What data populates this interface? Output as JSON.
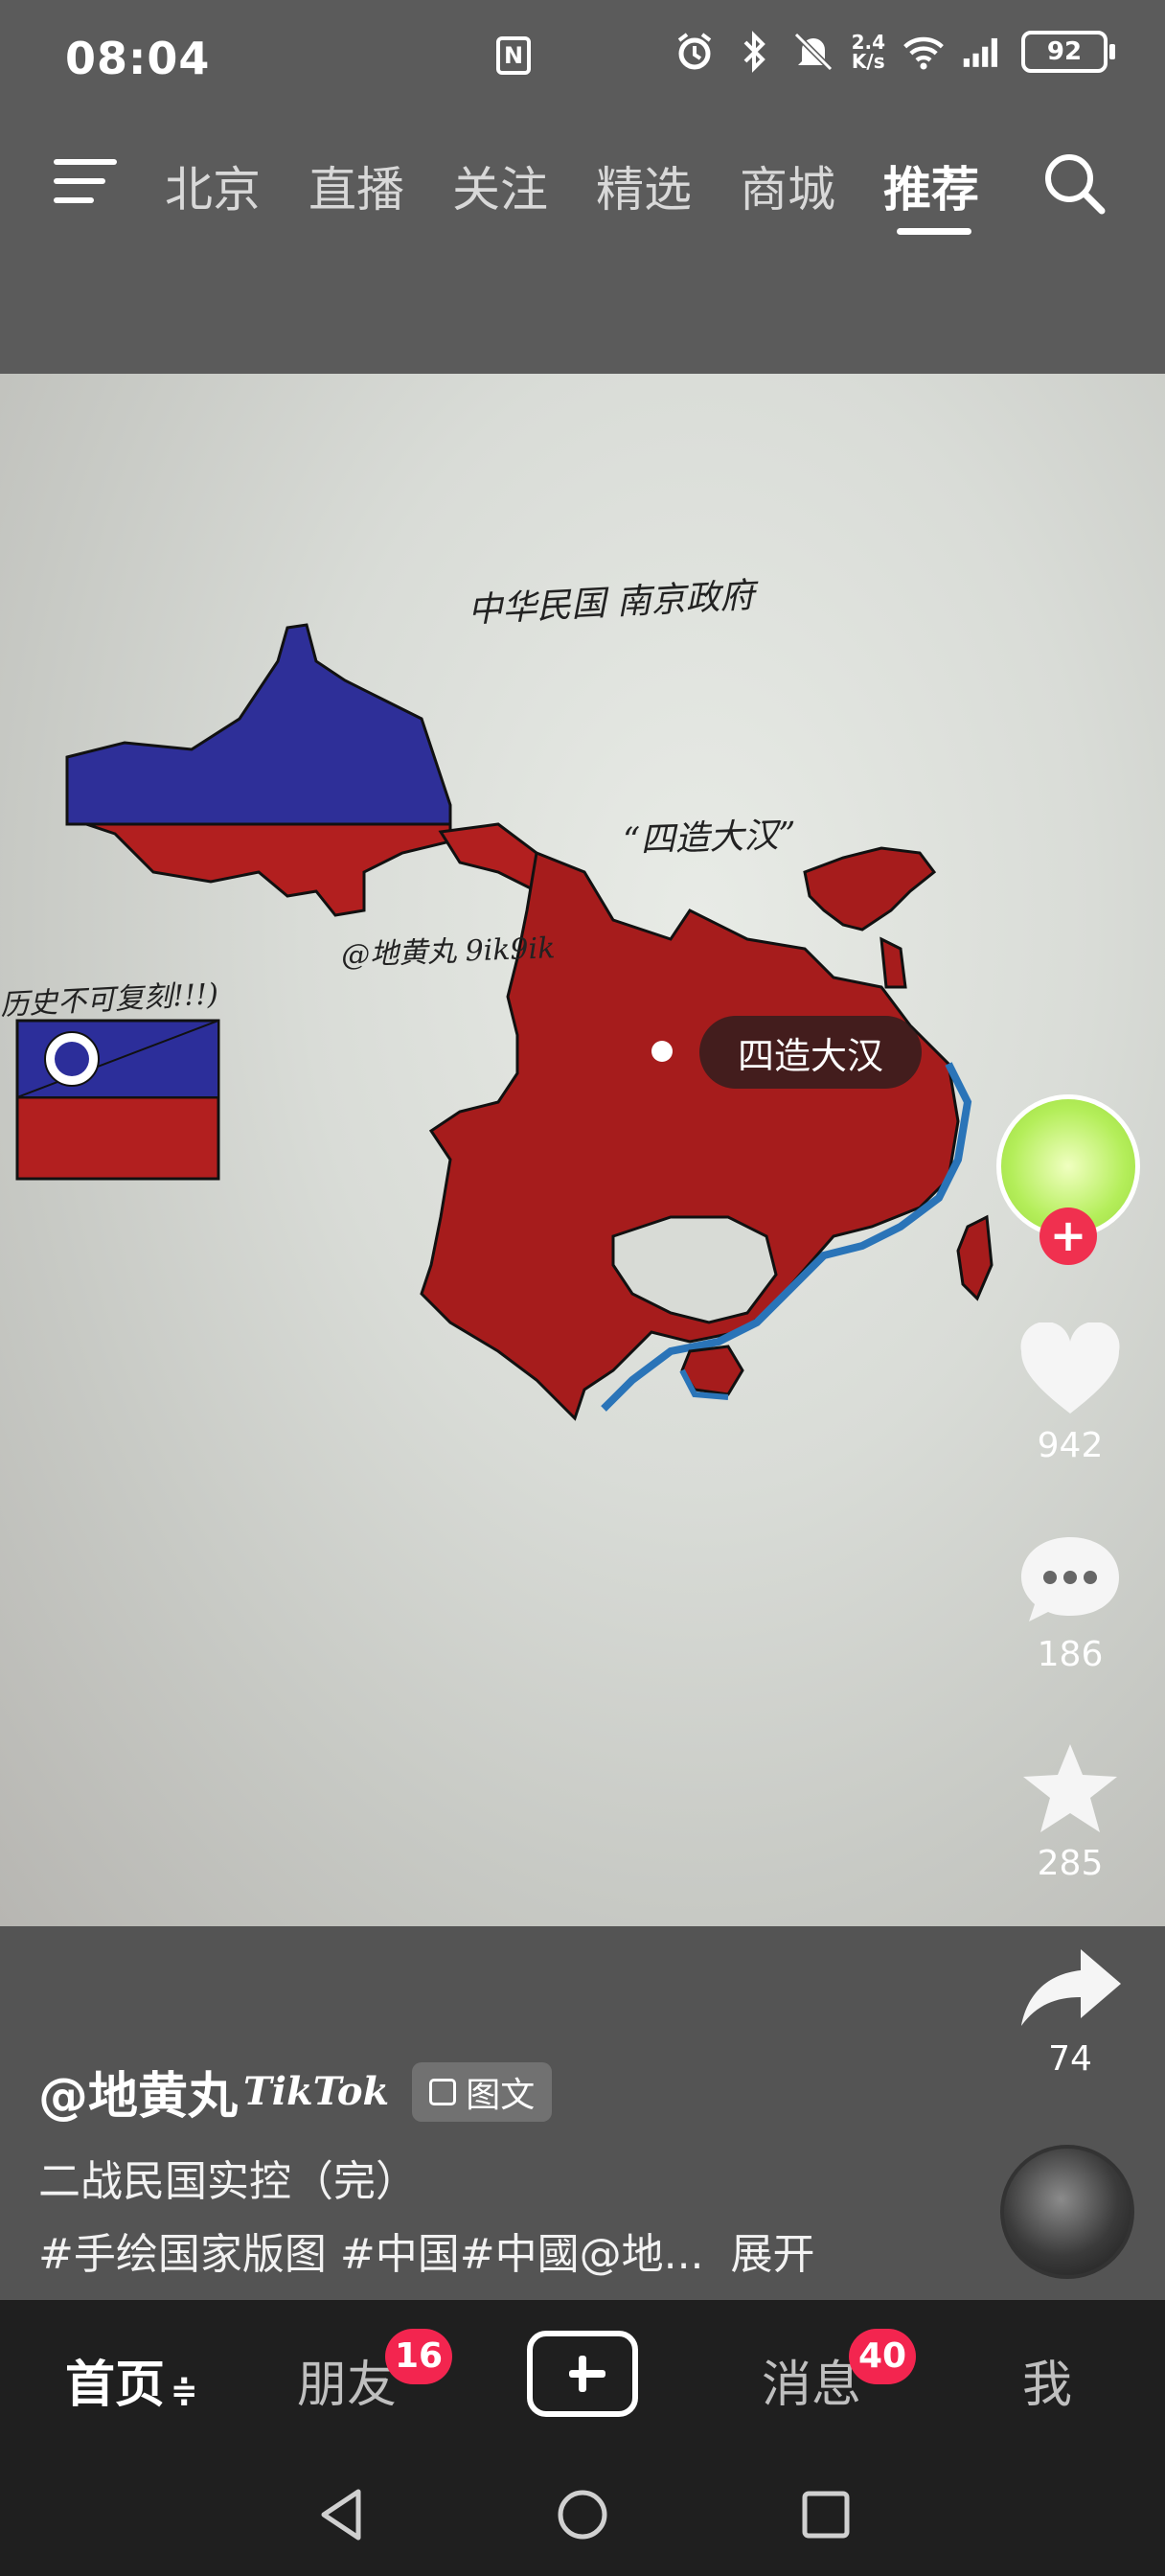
{
  "status_bar": {
    "time": "08:04",
    "nfc_label": "N",
    "net_speed_top": "2.4",
    "net_speed_bottom": "K/s",
    "battery": "92",
    "icons": [
      "nfc-icon",
      "alarm-icon",
      "bluetooth-icon",
      "mute-icon",
      "wifi-icon",
      "signal-icon",
      "battery-icon"
    ]
  },
  "top_nav": {
    "tabs": [
      "北京",
      "直播",
      "关注",
      "精选",
      "商城",
      "推荐"
    ],
    "active_tab": "推荐"
  },
  "photo": {
    "annotations": {
      "gov": "中华民国 南京政府",
      "quote": "“四造大汉”",
      "watermark": "@地黄丸 9ik9ik",
      "side_note": "历史不可复刻!!!)"
    },
    "location_label": "四造大汉"
  },
  "actions": {
    "likes": "942",
    "comments": "186",
    "favorites": "285",
    "shares": "74"
  },
  "caption": {
    "author": "@地黄丸",
    "author_tag": "TikTok",
    "badge": "图文",
    "description": "二战民国实控（完）",
    "hashtags": "#手绘国家版图 #中国#中國@地...",
    "expand": "展开"
  },
  "bottom_nav": {
    "home": "首页",
    "home_suffix": "≑",
    "friends": "朋友",
    "friends_badge": "16",
    "messages": "消息",
    "messages_badge": "40",
    "me": "我"
  },
  "colors": {
    "accent_red": "#f3254f",
    "map_red": "#a31c1c",
    "flag_blue": "#2c2e9a"
  }
}
